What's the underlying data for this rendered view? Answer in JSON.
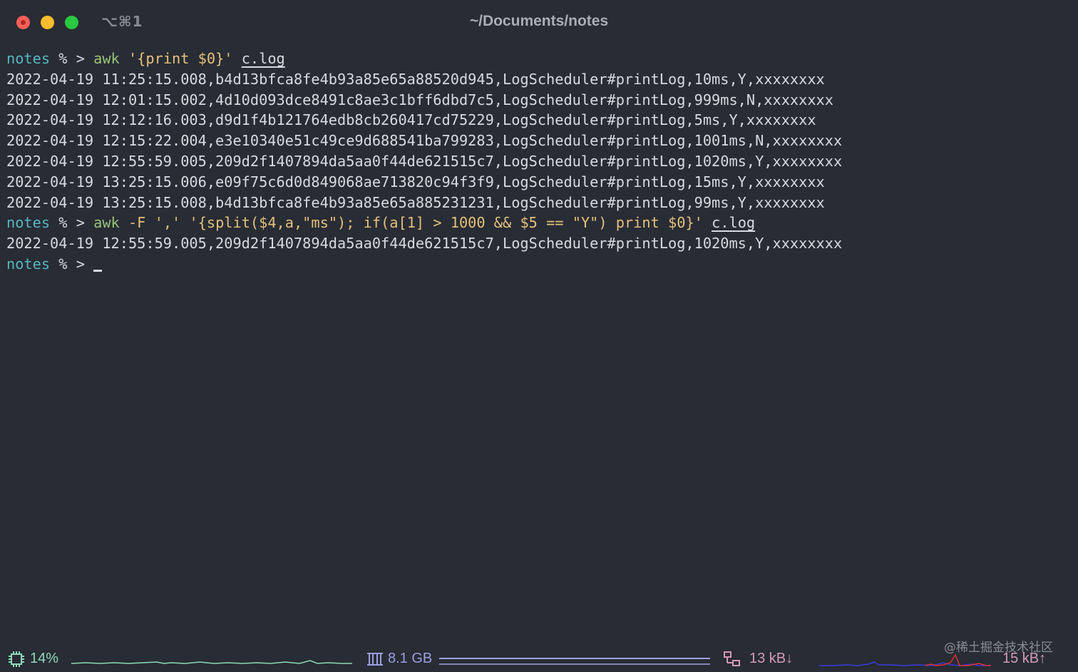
{
  "window": {
    "shortcut": "⌥⌘1",
    "title": "~/Documents/notes"
  },
  "terminal": {
    "prompt_dir": "notes",
    "prompt_symbol": " % >",
    "lines": [
      {
        "type": "prompt",
        "cmd": "awk",
        "args": " '{print $0}' ",
        "file": "c.log"
      },
      {
        "type": "output",
        "text": "2022-04-19 11:25:15.008,b4d13bfca8fe4b93a85e65a88520d945,LogScheduler#printLog,10ms,Y,xxxxxxxx"
      },
      {
        "type": "output",
        "text": "2022-04-19 12:01:15.002,4d10d093dce8491c8ae3c1bff6dbd7c5,LogScheduler#printLog,999ms,N,xxxxxxxx"
      },
      {
        "type": "output",
        "text": "2022-04-19 12:12:16.003,d9d1f4b121764edb8cb260417cd75229,LogScheduler#printLog,5ms,Y,xxxxxxxx"
      },
      {
        "type": "output",
        "text": "2022-04-19 12:15:22.004,e3e10340e51c49ce9d688541ba799283,LogScheduler#printLog,1001ms,N,xxxxxxxx"
      },
      {
        "type": "output",
        "text": "2022-04-19 12:55:59.005,209d2f1407894da5aa0f44de621515c7,LogScheduler#printLog,1020ms,Y,xxxxxxxx"
      },
      {
        "type": "output",
        "text": "2022-04-19 13:25:15.006,e09f75c6d0d849068ae713820c94f3f9,LogScheduler#printLog,15ms,Y,xxxxxxxx"
      },
      {
        "type": "output",
        "text": "2022-04-19 13:25:15.008,b4d13bfca8fe4b93a85e65a885231231,LogScheduler#printLog,99ms,Y,xxxxxxxx"
      },
      {
        "type": "prompt",
        "cmd": "awk",
        "args": " -F ',' '{split($4,a,\"ms\"); if(a[1] > 1000 && $5 == \"Y\") print $0}' ",
        "file": "c.log"
      },
      {
        "type": "output",
        "text": "2022-04-19 12:55:59.005,209d2f1407894da5aa0f44de621515c7,LogScheduler#printLog,1020ms,Y,xxxxxxxx"
      },
      {
        "type": "prompt_empty"
      }
    ]
  },
  "statusbar": {
    "cpu": "14%",
    "memory": "8.1 GB",
    "net_down": "13 kB↓",
    "net_up": "15 kB↑",
    "colors": {
      "cpu": "#8ed8b8",
      "memory": "#9b9fe0",
      "net": "#d69ab8"
    },
    "icons": [
      "cpu-icon",
      "memory-icon",
      "network-icon"
    ]
  },
  "watermark": "@稀土掘金技术社区"
}
